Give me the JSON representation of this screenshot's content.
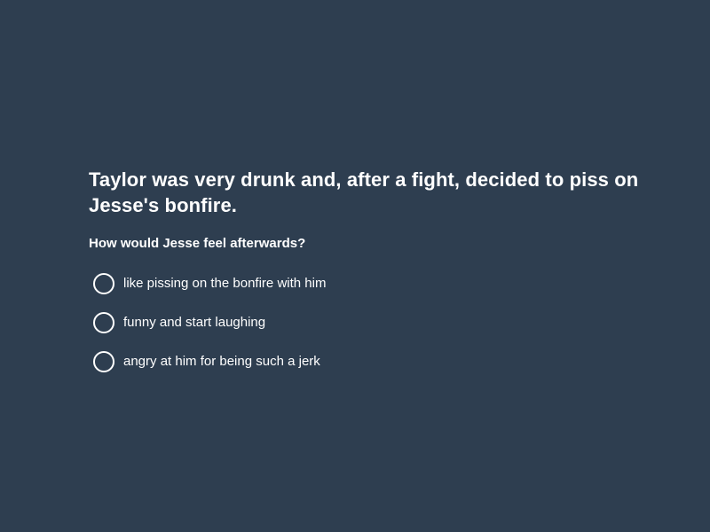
{
  "quiz": {
    "prompt": "Taylor was very drunk and, after a fight, decided to piss on Jesse's bonfire.",
    "question": "How would Jesse feel afterwards?",
    "options": [
      {
        "label": "like pissing on the bonfire with him",
        "selected": false
      },
      {
        "label": "funny and start laughing",
        "selected": false
      },
      {
        "label": "angry at him for being such a jerk",
        "selected": false
      }
    ]
  },
  "colors": {
    "background": "#2e3e50",
    "text": "#ffffff",
    "radio_border": "#ffffff"
  }
}
